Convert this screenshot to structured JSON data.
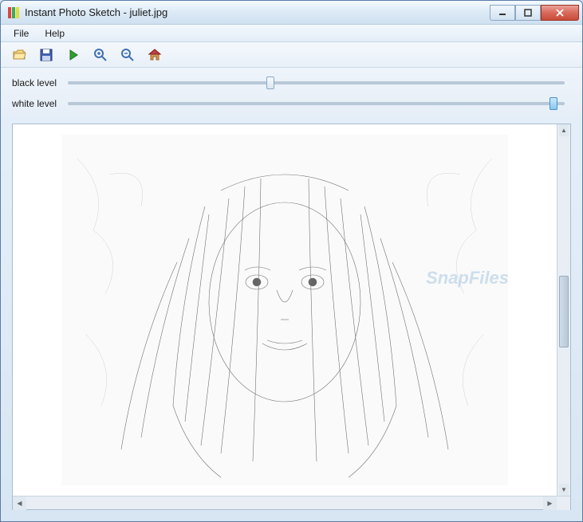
{
  "window": {
    "title": "Instant Photo Sketch - juliet.jpg"
  },
  "menu": {
    "file": "File",
    "help": "Help"
  },
  "toolbar": {
    "open_icon": "open-folder-icon",
    "save_icon": "save-floppy-icon",
    "run_icon": "play-icon",
    "zoom_in_icon": "zoom-in-icon",
    "zoom_out_icon": "zoom-out-icon",
    "home_icon": "home-icon"
  },
  "sliders": {
    "black_label": "black level",
    "black_value": 40,
    "white_label": "white level",
    "white_value": 97
  },
  "canvas": {
    "image_name": "juliet.jpg",
    "description": "pencil sketch of a woman with long wavy hair",
    "watermark": "SnapFiles"
  }
}
